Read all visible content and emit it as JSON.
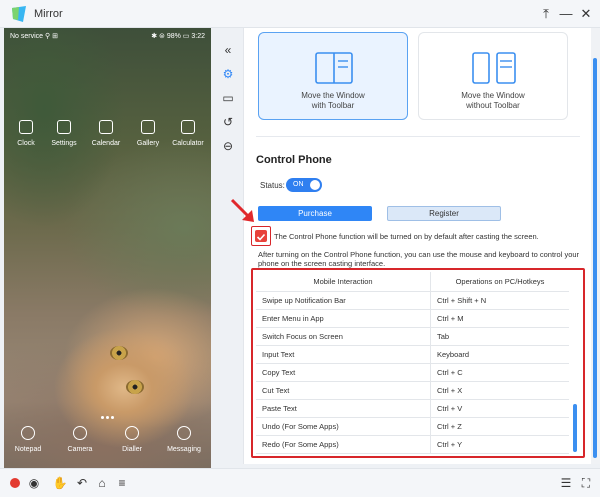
{
  "window": {
    "title": "Mirror",
    "pin_label": "⤒",
    "minimize_label": "—",
    "close_label": "✕"
  },
  "phone": {
    "status_left": "No service ⚲ ⊞",
    "status_right": "✱ ⊜ 98% ▭ 3:22",
    "apps": [
      "Clock",
      "Settings",
      "Calendar",
      "Gallery",
      "Calculator"
    ],
    "dock": [
      "Notepad",
      "Camera",
      "Dialler",
      "Messaging"
    ]
  },
  "rail": {
    "collapse": "«",
    "settings": "⚙",
    "record": "▭",
    "history": "↺",
    "minus": "⊖"
  },
  "modes": [
    {
      "line1": "Move the Window",
      "line2": "with Toolbar"
    },
    {
      "line1": "Move the Window",
      "line2": "without Toolbar"
    }
  ],
  "control_phone": {
    "title": "Control Phone",
    "status_label": "Status:",
    "toggle_label": "ON",
    "purchase_label": "Purchase",
    "register_label": "Register",
    "checkbox_text": "The Control Phone function will be turned on by default after casting the screen.",
    "description": "After turning on the Control Phone function, you can use the mouse and keyboard to control your phone on the screen casting interface."
  },
  "table": {
    "headers": [
      "Mobile Interaction",
      "Operations on PC/Hotkeys"
    ],
    "rows": [
      [
        "Swipe up Notification Bar",
        "Ctrl + Shift + N"
      ],
      [
        "Enter Menu in App",
        "Ctrl + M"
      ],
      [
        "Switch Focus on Screen",
        "Tab"
      ],
      [
        "Input Text",
        "Keyboard"
      ],
      [
        "Copy Text",
        "Ctrl + C"
      ],
      [
        "Cut Text",
        "Ctrl + X"
      ],
      [
        "Paste Text",
        "Ctrl + V"
      ],
      [
        "Undo (For Some Apps)",
        "Ctrl + Z"
      ],
      [
        "Redo (For Some Apps)",
        "Ctrl + Y"
      ]
    ]
  },
  "bottombar": {
    "camera": "◉",
    "hand": "✋",
    "back": "↶",
    "home": "⌂",
    "menu": "≡",
    "settings_list": "☰",
    "fullscreen": "⛶"
  },
  "colors": {
    "accent": "#2f86f6",
    "highlight": "#d7262a",
    "record": "#e33a30"
  }
}
